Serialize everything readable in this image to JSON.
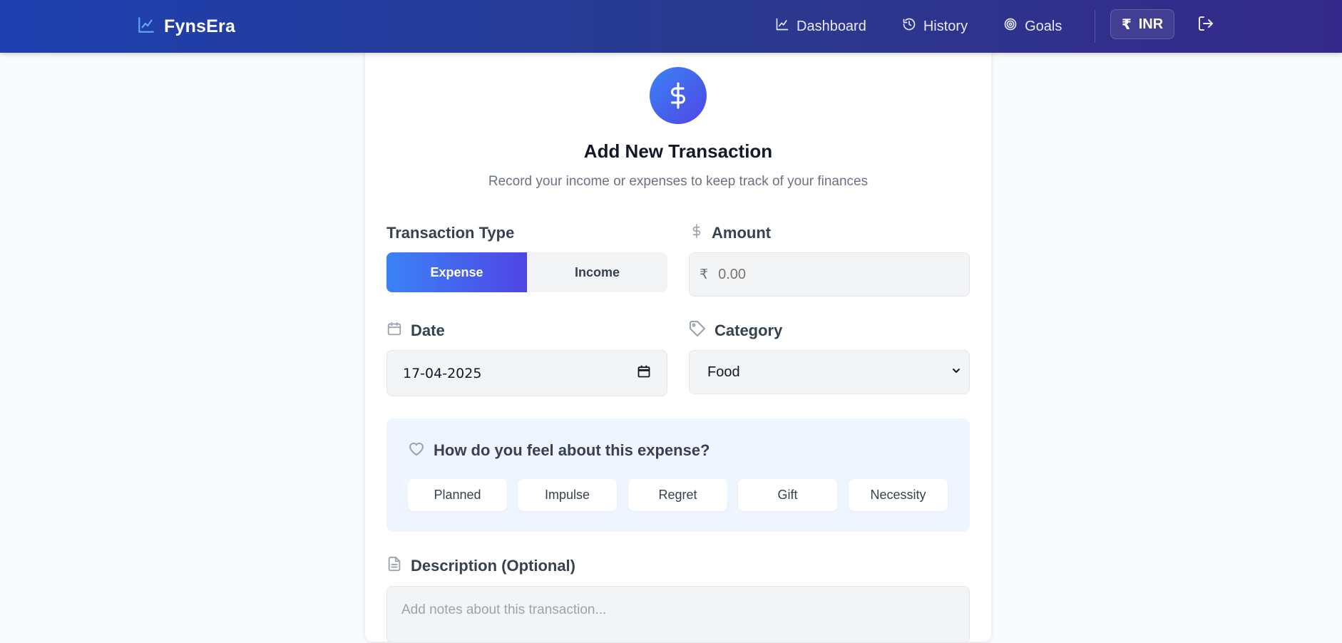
{
  "header": {
    "brand": "FynsEra",
    "nav": [
      {
        "label": "Dashboard",
        "icon": "chart-line-icon"
      },
      {
        "label": "History",
        "icon": "history-icon"
      },
      {
        "label": "Goals",
        "icon": "target-icon"
      }
    ],
    "currency": {
      "symbol": "₹",
      "code": "INR"
    },
    "logout_icon": "logout-icon"
  },
  "form": {
    "hero_icon": "dollar-icon",
    "title": "Add New Transaction",
    "subtitle": "Record your income or expenses to keep track of your finances",
    "transaction_type": {
      "label": "Transaction Type",
      "options": [
        "Expense",
        "Income"
      ],
      "selected": "Expense"
    },
    "amount": {
      "label": "Amount",
      "currency_symbol": "₹",
      "placeholder": "0.00"
    },
    "date": {
      "label": "Date",
      "value": "17-04-2025"
    },
    "category": {
      "label": "Category",
      "value": "Food"
    },
    "feeling": {
      "question": "How do you feel about this expense?",
      "options": [
        "Planned",
        "Impulse",
        "Regret",
        "Gift",
        "Necessity"
      ]
    },
    "description": {
      "label": "Description (Optional)",
      "placeholder": "Add notes about this transaction..."
    }
  },
  "colors": {
    "accent_start": "#3b82f6",
    "accent_end": "#4f46e5",
    "header_start": "#1e40af",
    "header_end": "#34298a"
  }
}
